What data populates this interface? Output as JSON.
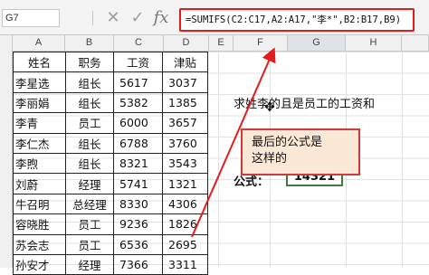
{
  "formula_bar": {
    "name_box": "G7",
    "cancel_icon": "✕",
    "enter_icon": "✓",
    "fx_label": "fx",
    "formula": "=SUMIFS(C2:C17,A2:A17,\"李*\",B2:B17,B9)"
  },
  "columns": [
    "A",
    "B",
    "C",
    "D",
    "E",
    "F",
    "G",
    "H"
  ],
  "table": {
    "headers": [
      "姓名",
      "职务",
      "工资",
      "津贴"
    ],
    "rows": [
      [
        "李星选",
        "组长",
        "5617",
        "3037"
      ],
      [
        "李丽娟",
        "组长",
        "5382",
        "1385"
      ],
      [
        "李青",
        "员工",
        "6000",
        "3657"
      ],
      [
        "李仁杰",
        "组长",
        "6788",
        "3760"
      ],
      [
        "李煦",
        "组长",
        "8321",
        "3543"
      ],
      [
        "刘蔚",
        "经理",
        "5741",
        "1321"
      ],
      [
        "牛召明",
        "总经理",
        "8330",
        "4306"
      ],
      [
        "容晓胜",
        "员工",
        "9236",
        "1826"
      ],
      [
        "苏会志",
        "员工",
        "6536",
        "2695"
      ],
      [
        "孙安才",
        "经理",
        "7366",
        "3311"
      ]
    ]
  },
  "note": "求姓李的且是员工的工资和",
  "result": {
    "label": "公式：",
    "value": "14321"
  },
  "callout": {
    "line1": "最后的公式是",
    "line2": "这样的"
  },
  "colors": {
    "arrow": "#e31b1b",
    "callout_bg": "#fbe7d6",
    "result_border": "#3e7d3f"
  }
}
